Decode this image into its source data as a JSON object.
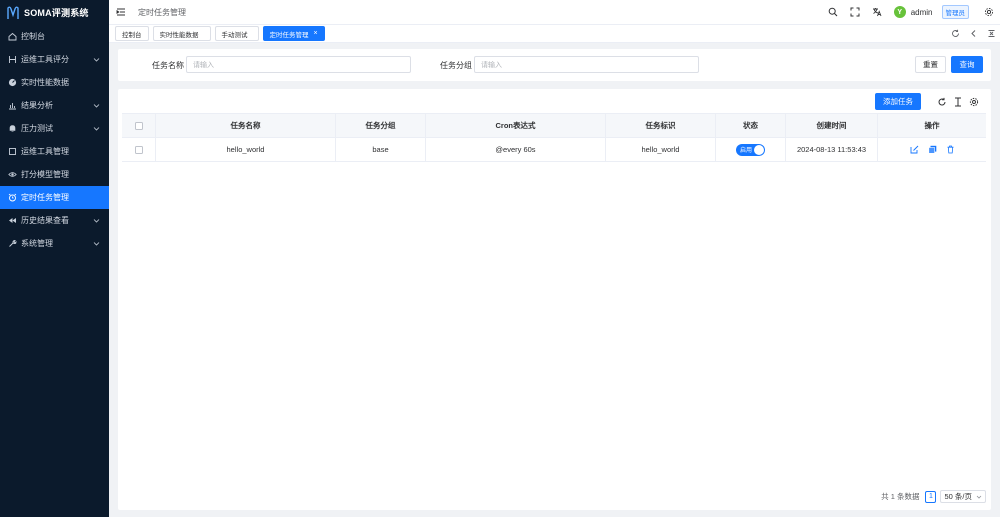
{
  "app": {
    "name": "SOMA评测系统"
  },
  "sidebar": {
    "items": [
      {
        "label": "控制台",
        "icon": "home-icon",
        "expandable": false,
        "active": false
      },
      {
        "label": "运维工具评分",
        "icon": "tools-icon",
        "expandable": true,
        "active": false
      },
      {
        "label": "实时性能数据",
        "icon": "gauge-icon",
        "expandable": false,
        "active": false
      },
      {
        "label": "结果分析",
        "icon": "bar-chart-icon",
        "expandable": true,
        "active": false
      },
      {
        "label": "压力测试",
        "icon": "bell-icon",
        "expandable": true,
        "active": false
      },
      {
        "label": "运维工具管理",
        "icon": "box-icon",
        "expandable": false,
        "active": false
      },
      {
        "label": "打分模型管理",
        "icon": "eye-icon",
        "expandable": false,
        "active": false
      },
      {
        "label": "定时任务管理",
        "icon": "alarm-clock-icon",
        "expandable": false,
        "active": true
      },
      {
        "label": "历史结果查看",
        "icon": "rewind-icon",
        "expandable": true,
        "active": false
      },
      {
        "label": "系统管理",
        "icon": "wrench-icon",
        "expandable": true,
        "active": false
      }
    ]
  },
  "header": {
    "breadcrumb": "定时任务管理",
    "user": {
      "avatar_text": "Y",
      "name": "admin",
      "role": "管理员"
    }
  },
  "tabs": [
    {
      "label": "控制台",
      "active": false,
      "closable": false
    },
    {
      "label": "实时性能数据",
      "active": false,
      "closable": false
    },
    {
      "label": "手动测试",
      "active": false,
      "closable": false
    },
    {
      "label": "定时任务管理",
      "active": true,
      "closable": true,
      "close_glyph": "×"
    }
  ],
  "search": {
    "name_label": "任务名称",
    "name_placeholder": "请输入",
    "group_label": "任务分组",
    "group_placeholder": "请输入",
    "reset_label": "重置",
    "query_label": "查询"
  },
  "toolbar": {
    "add_label": "添加任务"
  },
  "table": {
    "columns": [
      "任务名称",
      "任务分组",
      "Cron表达式",
      "任务标识",
      "状态",
      "创建时间",
      "操作"
    ],
    "rows": [
      {
        "name": "hello_world",
        "group": "base",
        "cron": "@every 60s",
        "identifier": "hello_world",
        "status_label": "启用",
        "status_on": true,
        "created": "2024-08-13 11:53:43"
      }
    ]
  },
  "pagination": {
    "total_text": "共 1 条数据",
    "current_page": "1",
    "page_size": "50 条/页"
  },
  "colors": {
    "accent": "#1677ff",
    "sidebar_bg": "#0b1a2c",
    "avatar": "#67c23a"
  }
}
